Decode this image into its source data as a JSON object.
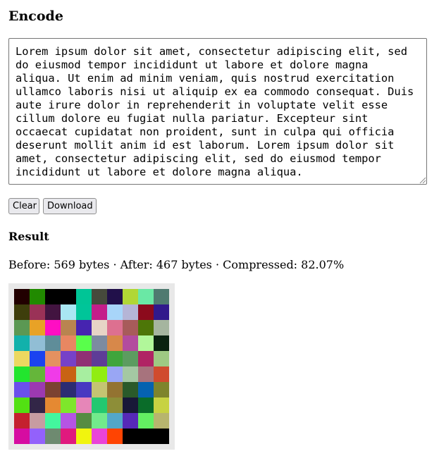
{
  "encode": {
    "heading": "Encode",
    "input_text": "Lorem ipsum dolor sit amet, consectetur adipiscing elit, sed do eiusmod tempor incididunt ut labore et dolore magna aliqua. Ut enim ad minim veniam, quis nostrud exercitation ullamco laboris nisi ut aliquip ex ea commodo consequat. Duis aute irure dolor in reprehenderit in voluptate velit esse cillum dolore eu fugiat nulla pariatur. Excepteur sint occaecat cupidatat non proident, sunt in culpa qui officia deserunt mollit anim id est laborum. Lorem ipsum dolor sit amet, consectetur adipiscing elit, sed do eiusmod tempor incididunt ut labore et dolore magna aliqua."
  },
  "buttons": {
    "clear": "Clear",
    "download": "Download"
  },
  "result": {
    "heading": "Result",
    "stats": "Before: 569 bytes · After: 467 bytes · Compressed: 82.07%",
    "pixels": [
      [
        "#210000",
        "#218a00",
        "#000000",
        "#000000",
        "#00c596",
        "#464a3c",
        "#21104a",
        "#b1d735",
        "#6ae8a5",
        "#4f7a70"
      ],
      [
        "#3e3e0c",
        "#9a3257",
        "#421440",
        "#a9e7f3",
        "#00c599",
        "#c41e8a",
        "#a8d5f9",
        "#b5b5d6",
        "#8c0a1c",
        "#31198c"
      ],
      [
        "#5b9853",
        "#e8a226",
        "#ff0ec3",
        "#b98450",
        "#4624b0",
        "#e7d4c6",
        "#dd7090",
        "#a85b5a",
        "#4d7608",
        "#a5b59f"
      ],
      [
        "#12b1ab",
        "#91bed5",
        "#5f8d99",
        "#e88762",
        "#59fe4b",
        "#7c8ba0",
        "#d7884a",
        "#b34c9e",
        "#b1f79a",
        "#0a2210"
      ],
      [
        "#ecd860",
        "#1b43f0",
        "#e49160",
        "#7641c8",
        "#903074",
        "#5e3c97",
        "#3fa53c",
        "#5c9c60",
        "#b02464",
        "#9ec983"
      ],
      [
        "#22e52e",
        "#65b63a",
        "#f03be8",
        "#c86313",
        "#a7eea0",
        "#91ed12",
        "#99a6f4",
        "#a4c8a3",
        "#a7737d",
        "#d04b2e"
      ],
      [
        "#6b50eb",
        "#9c39b1",
        "#7c4231",
        "#2c2c72",
        "#4839c1",
        "#c4c472",
        "#937331",
        "#2a5a2a",
        "#0562b0",
        "#7e842c"
      ],
      [
        "#52e112",
        "#322647",
        "#e58932",
        "#7ee62b",
        "#e686b8",
        "#23c870",
        "#8d8e38",
        "#181838",
        "#0a6c29",
        "#c7d242"
      ],
      [
        "#c4212e",
        "#c79ca1",
        "#43f79e",
        "#b554e4",
        "#568c42",
        "#72ea8c",
        "#53a7c9",
        "#5629b8",
        "#63ef62",
        "#b7b56e"
      ],
      [
        "#d60ca1",
        "#9361fb",
        "#6e8a70",
        "#e0197e",
        "#f1f40e",
        "#ea44d7",
        "#ff4402",
        "#000000",
        "#000000",
        "#000000"
      ]
    ]
  }
}
